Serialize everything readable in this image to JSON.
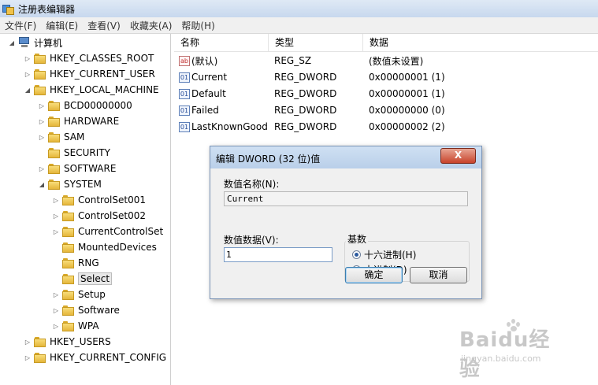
{
  "window": {
    "title": "注册表编辑器"
  },
  "menu": [
    "文件(F)",
    "编辑(E)",
    "查看(V)",
    "收藏夹(A)",
    "帮助(H)"
  ],
  "tree": {
    "root": "计算机",
    "nodes": [
      {
        "label": "HKEY_CLASSES_ROOT",
        "level": 1,
        "state": "collapsed"
      },
      {
        "label": "HKEY_CURRENT_USER",
        "level": 1,
        "state": "collapsed"
      },
      {
        "label": "HKEY_LOCAL_MACHINE",
        "level": 1,
        "state": "expanded"
      },
      {
        "label": "BCD00000000",
        "level": 2,
        "state": "collapsed"
      },
      {
        "label": "HARDWARE",
        "level": 2,
        "state": "collapsed"
      },
      {
        "label": "SAM",
        "level": 2,
        "state": "collapsed"
      },
      {
        "label": "SECURITY",
        "level": 2,
        "state": "none"
      },
      {
        "label": "SOFTWARE",
        "level": 2,
        "state": "collapsed"
      },
      {
        "label": "SYSTEM",
        "level": 2,
        "state": "expanded"
      },
      {
        "label": "ControlSet001",
        "level": 3,
        "state": "collapsed"
      },
      {
        "label": "ControlSet002",
        "level": 3,
        "state": "collapsed"
      },
      {
        "label": "CurrentControlSet",
        "level": 3,
        "state": "collapsed"
      },
      {
        "label": "MountedDevices",
        "level": 3,
        "state": "none"
      },
      {
        "label": "RNG",
        "level": 3,
        "state": "none"
      },
      {
        "label": "Select",
        "level": 3,
        "state": "none",
        "selected": true
      },
      {
        "label": "Setup",
        "level": 3,
        "state": "collapsed"
      },
      {
        "label": "Software",
        "level": 3,
        "state": "collapsed"
      },
      {
        "label": "WPA",
        "level": 3,
        "state": "collapsed"
      },
      {
        "label": "HKEY_USERS",
        "level": 1,
        "state": "collapsed"
      },
      {
        "label": "HKEY_CURRENT_CONFIG",
        "level": 1,
        "state": "collapsed"
      }
    ]
  },
  "list": {
    "columns": [
      "名称",
      "类型",
      "数据"
    ],
    "rows": [
      {
        "name": "(默认)",
        "type": "REG_SZ",
        "data": "(数值未设置)",
        "icon": "ab-string-icon"
      },
      {
        "name": "Current",
        "type": "REG_DWORD",
        "data": "0x00000001 (1)",
        "icon": "binary-value-icon"
      },
      {
        "name": "Default",
        "type": "REG_DWORD",
        "data": "0x00000001 (1)",
        "icon": "binary-value-icon"
      },
      {
        "name": "Failed",
        "type": "REG_DWORD",
        "data": "0x00000000 (0)",
        "icon": "binary-value-icon"
      },
      {
        "name": "LastKnownGood",
        "type": "REG_DWORD",
        "data": "0x00000002 (2)",
        "icon": "binary-value-icon"
      }
    ]
  },
  "dialog": {
    "title": "编辑 DWORD (32 位)值",
    "close_label": "X",
    "name_label": "数值名称(N):",
    "name_value": "Current",
    "data_label": "数值数据(V):",
    "data_value": "1",
    "base_label": "基数",
    "hex_label": "十六进制(H)",
    "dec_label": "十进制(D)",
    "ok_label": "确定",
    "cancel_label": "取消",
    "selected_base": "hex"
  },
  "watermark": {
    "brand": "Baidu经验",
    "url": "jingyan.baidu.com"
  }
}
